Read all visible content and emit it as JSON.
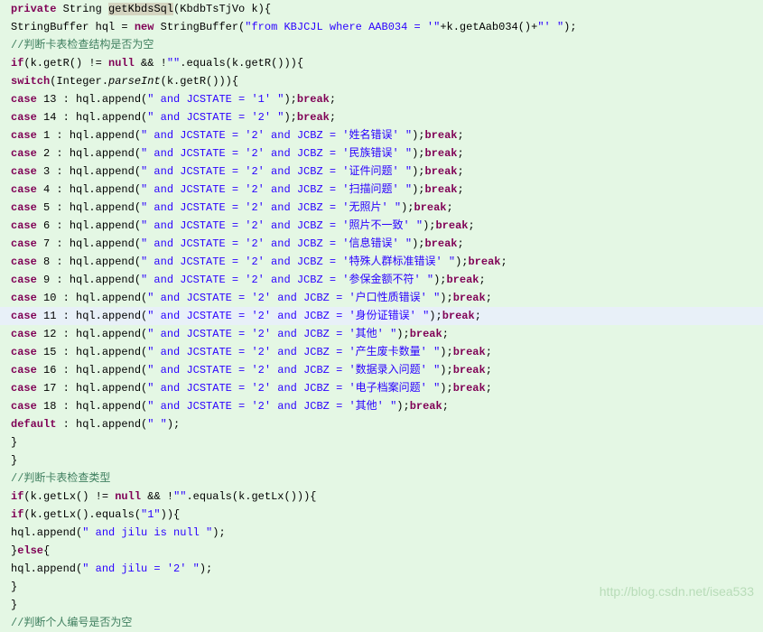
{
  "code": {
    "method_signature": {
      "access": "private",
      "return_type": "String",
      "method_name": "getKbdsSql",
      "param_type": "KbdbTsTjVo",
      "param_name": "k"
    },
    "line2_var": "StringBuffer hql = ",
    "line2_new": "new",
    "line2_ctor": " StringBuffer(",
    "line2_str": "\"from KBJCJL where  AAB034 = '\"",
    "line2_tail": "+k.getAab034()+",
    "line2_str2": "\"' \"",
    "line2_end": ");",
    "comment1": "//判断卡表检查结构是否为空",
    "if1_a": "if",
    "if1_b": "(k.getR() != ",
    "if1_null": "null",
    "if1_c": " && !",
    "if1_empty": "\"\"",
    "if1_d": ".equals(k.getR())){",
    "switch_a": "switch",
    "switch_b": "(Integer.",
    "switch_parse": "parseInt",
    "switch_c": "(k.getR())){",
    "cases": [
      {
        "n": "13",
        "str": "\" and  JCSTATE = '1' \"",
        "jcbz": null
      },
      {
        "n": "14",
        "str": "\" and  JCSTATE = '2' \"",
        "jcbz": null
      },
      {
        "n": "1",
        "str": "\" and  JCSTATE = '2' and  JCBZ = '姓名错误' \"",
        "jcbz": true
      },
      {
        "n": "2",
        "str": "\" and  JCSTATE = '2' and  JCBZ = '民族错误' \"",
        "jcbz": true
      },
      {
        "n": "3",
        "str": "\" and  JCSTATE = '2' and  JCBZ = '证件问题' \"",
        "jcbz": true
      },
      {
        "n": "4",
        "str": "\" and  JCSTATE = '2' and  JCBZ = '扫描问题' \"",
        "jcbz": true
      },
      {
        "n": "5",
        "str": "\" and  JCSTATE = '2' and  JCBZ = '无照片' \"",
        "jcbz": true
      },
      {
        "n": "6",
        "str": "\" and  JCSTATE = '2' and  JCBZ = '照片不一致' \"",
        "jcbz": true
      },
      {
        "n": "7",
        "str": "\" and  JCSTATE = '2' and  JCBZ = '信息错误' \"",
        "jcbz": true
      },
      {
        "n": "8",
        "str": "\" and  JCSTATE = '2' and  JCBZ = '特殊人群标准错误' \"",
        "jcbz": true
      },
      {
        "n": "9",
        "str": "\" and  JCSTATE = '2' and  JCBZ = '参保金额不符' \"",
        "jcbz": true
      },
      {
        "n": "10",
        "str": "\" and  JCSTATE = '2' and  JCBZ = '户口性质错误' \"",
        "jcbz": true
      },
      {
        "n": "11",
        "str": "\" and  JCSTATE = '2' and  JCBZ = '身份证错误' \"",
        "jcbz": true,
        "hl": true
      },
      {
        "n": "12",
        "str": "\" and  JCSTATE = '2' and  JCBZ = '其他' \"",
        "jcbz": true
      },
      {
        "n": "15",
        "str": "\" and  JCSTATE = '2' and  JCBZ = '产生废卡数量' \"",
        "jcbz": true
      },
      {
        "n": "16",
        "str": "\" and  JCSTATE = '2' and  JCBZ = '数据录入问题' \"",
        "jcbz": true
      },
      {
        "n": "17",
        "str": "\" and  JCSTATE = '2' and  JCBZ = '电子档案问题' \"",
        "jcbz": true
      },
      {
        "n": "18",
        "str": "\" and  JCSTATE = '2' and  JCBZ = '其他' \"",
        "jcbz": true
      }
    ],
    "default_kw": "default",
    "default_tail": " :  hql.append(",
    "default_str": "\" \"",
    "default_end": ");",
    "close_brace": "}",
    "comment2": "//判断卡表检查类型",
    "if2_a": "if",
    "if2_b": "(k.getLx() != ",
    "if2_null": "null",
    "if2_c": " && !",
    "if2_empty": "\"\"",
    "if2_d": ".equals(k.getLx())){",
    "if3_a": "if",
    "if3_b": "(k.getLx().equals(",
    "if3_str": "\"1\"",
    "if3_c": ")){",
    "append1_a": "hql.append(",
    "append1_str": "\" and jilu is null \"",
    "append1_b": ");",
    "else_a": "}",
    "else_kw": "else",
    "else_b": "{",
    "append2_a": "hql.append(",
    "append2_str": "\" and jilu = '2' \"",
    "append2_b": ");",
    "comment3": "//判断个人编号是否为空"
  },
  "tokens": {
    "case": "case",
    "break": "break",
    "append_prefix": " :  hql.append(",
    "append_suffix_a": ");",
    "append_suffix_b": ";"
  },
  "watermark": "http://blog.csdn.net/isea533"
}
